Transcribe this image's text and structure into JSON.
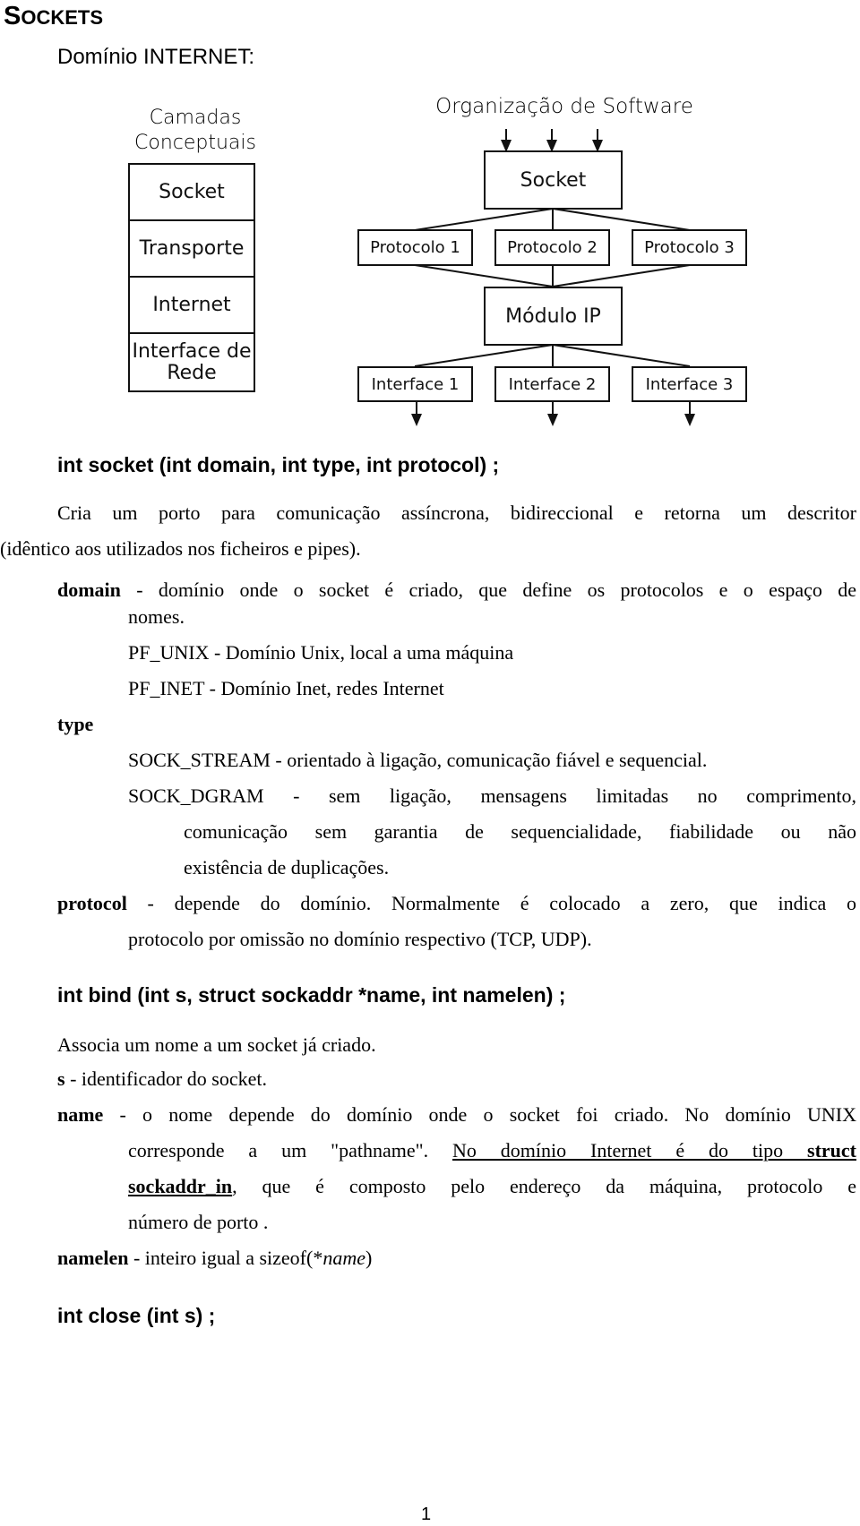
{
  "title": {
    "first": "S",
    "rest": "OCKETS"
  },
  "subtitle": "Domínio INTERNET:",
  "diagram": {
    "conceptual_header": [
      "Camadas",
      "Conceptuais"
    ],
    "conceptual_layers": [
      "Socket",
      "Transporte",
      "Internet",
      "Interface de Rede"
    ],
    "software_header": "Organização de Software",
    "socket_box": "Socket",
    "protocols": [
      "Protocolo 1",
      "Protocolo 2",
      "Protocolo 3"
    ],
    "ip_module": "Módulo IP",
    "interfaces": [
      "Interface 1",
      "Interface 2",
      "Interface 3"
    ]
  },
  "socket_fn": {
    "signature": "int socket (int domain, int type, int protocol) ;",
    "desc_line1": "Cria um porto para comunicação assíncrona, bidireccional e retorna um descritor",
    "desc_line2": "(idêntico aos utilizados nos ficheiros e pipes).",
    "domain": {
      "term": "domain",
      "text1": " - domínio onde o socket é criado, que define os protocolos e o espaço de",
      "text2": "nomes.",
      "options": [
        "PF_UNIX - Domínio Unix, local a uma máquina",
        "PF_INET - Domínio Inet, redes Internet"
      ]
    },
    "type": {
      "term": "type",
      "stream": "SOCK_STREAM - orientado à ligação, comunicação fiável e sequencial.",
      "dgram1": "SOCK_DGRAM - sem ligação, mensagens limitadas no comprimento,",
      "dgram2": "comunicação sem garantia de sequencialidade, fiabilidade ou não",
      "dgram3": "existência de duplicações."
    },
    "protocol": {
      "term": "protocol",
      "text1": " - depende do domínio. Normalmente é colocado a zero, que indica o",
      "text2": "protocolo por omissão no domínio respectivo (TCP, UDP)."
    }
  },
  "bind_fn": {
    "signature": "int bind (int s, struct sockaddr *name, int namelen) ;",
    "desc": "Associa um nome a um socket já criado.",
    "s": {
      "term": "s",
      "text": " - identificador do socket."
    },
    "name": {
      "term": "name",
      "text1": " - o nome depende do domínio onde o socket foi criado. No domínio UNIX",
      "text2a": "corresponde a um \"pathname\". ",
      "text2b": "No domínio Internet é do tipo ",
      "text2c": "struct",
      "text3a": "sockaddr_in",
      "text3b": ", que é composto pelo endereço da máquina, protocolo e",
      "text4": "número de porto ."
    },
    "namelen": {
      "term": "namelen",
      "text": " - inteiro igual a sizeof(*",
      "ital": "name",
      "close": ")"
    }
  },
  "close_fn": {
    "signature": "int close (int s) ;"
  },
  "page_number": "1"
}
